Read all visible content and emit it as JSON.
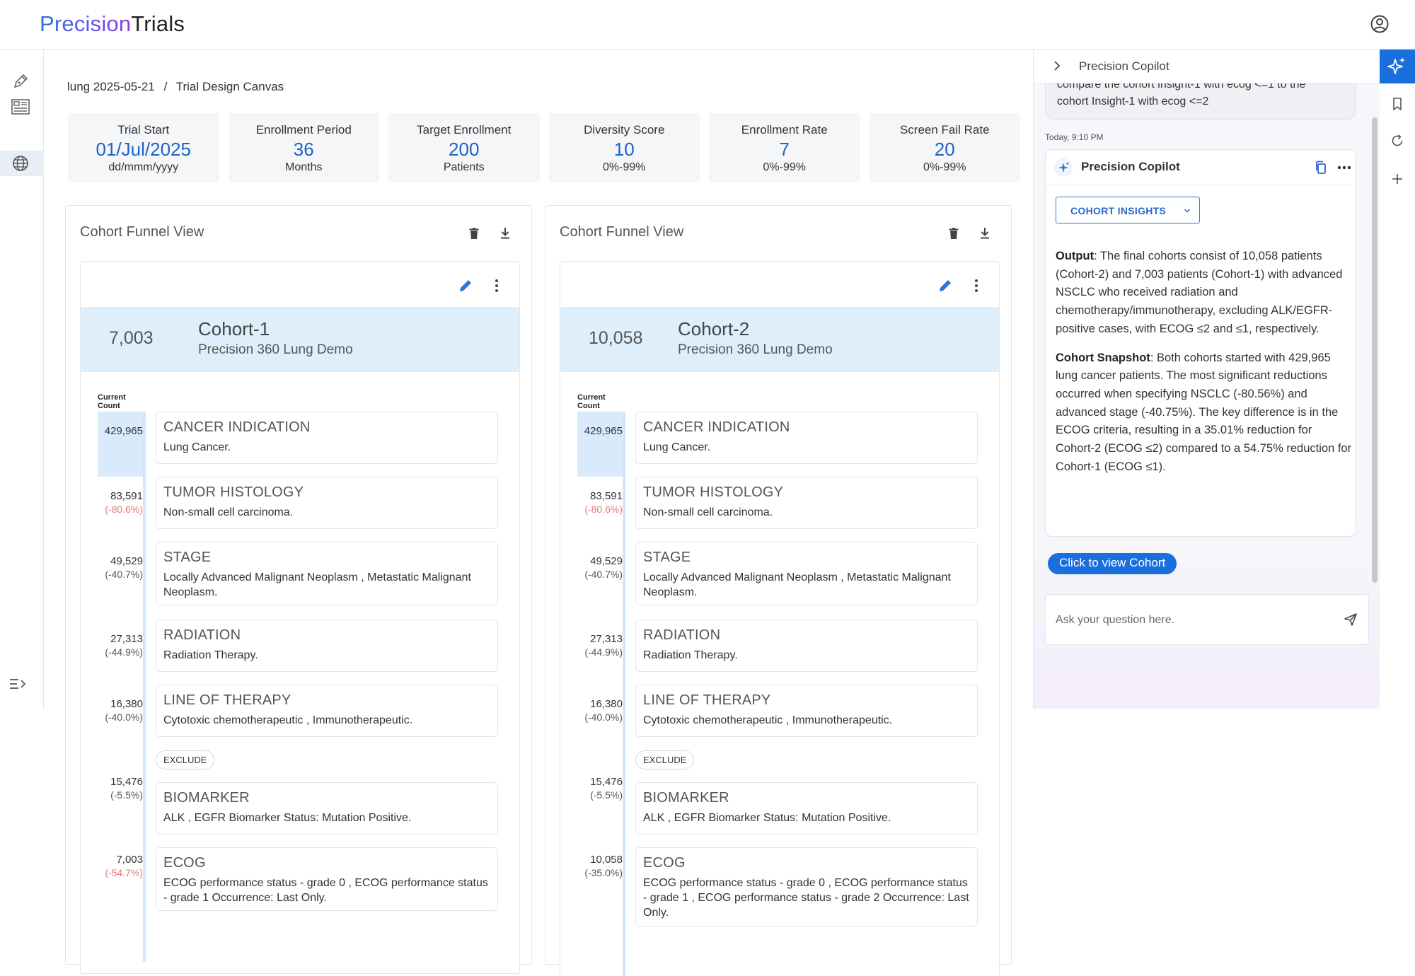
{
  "app": {
    "logo_part1": "Precision",
    "logo_part2": "Trials"
  },
  "breadcrumb": {
    "project": "lung 2025-05-21",
    "separator": "/",
    "page": "Trial Design Canvas"
  },
  "metrics": [
    {
      "label": "Trial Start",
      "value": "01/Jul/2025",
      "sub": "dd/mmm/yyyy"
    },
    {
      "label": "Enrollment Period",
      "value": "36",
      "sub": "Months"
    },
    {
      "label": "Target Enrollment",
      "value": "200",
      "sub": "Patients"
    },
    {
      "label": "Diversity Score",
      "value": "10",
      "sub": "0%-99%"
    },
    {
      "label": "Enrollment Rate",
      "value": "7",
      "sub": "0%-99%"
    },
    {
      "label": "Screen Fail Rate",
      "value": "20",
      "sub": "0%-99%"
    }
  ],
  "panels": [
    {
      "title": "Cohort Funnel View",
      "cohort_count": "7,003",
      "cohort_name": "Cohort-1",
      "cohort_desc": "Precision 360 Lung Demo",
      "current_count_label1": "Current",
      "current_count_label2": "Count",
      "steps": [
        {
          "count": "429,965",
          "pct": "",
          "title": "CANCER INDICATION",
          "desc": "Lung Cancer."
        },
        {
          "count": "83,591",
          "pct": "(-80.6%)",
          "title": "TUMOR HISTOLOGY",
          "desc": "Non-small cell carcinoma."
        },
        {
          "count": "49,529",
          "pct": "(-40.7%)",
          "title": "STAGE",
          "desc": "Locally Advanced Malignant Neoplasm , Metastatic Malignant Neoplasm."
        },
        {
          "count": "27,313",
          "pct": "(-44.9%)",
          "title": "RADIATION",
          "desc": "Radiation Therapy."
        },
        {
          "count": "16,380",
          "pct": "(-40.0%)",
          "title": "LINE OF THERAPY",
          "desc": "Cytotoxic chemotherapeutic , Immunotherapeutic."
        },
        {
          "count": "15,476",
          "pct": "(-5.5%)",
          "title": "BIOMARKER",
          "desc": "ALK , EGFR Biomarker Status: Mutation Positive."
        },
        {
          "count": "7,003",
          "pct": "(-54.7%)",
          "title": "ECOG",
          "desc": "ECOG performance status - grade 0 , ECOG performance status - grade 1 Occurrence: Last Only."
        }
      ],
      "exclude_label": "EXCLUDE"
    },
    {
      "title": "Cohort Funnel View",
      "cohort_count": "10,058",
      "cohort_name": "Cohort-2",
      "cohort_desc": "Precision 360 Lung Demo",
      "current_count_label1": "Current",
      "current_count_label2": "Count",
      "steps": [
        {
          "count": "429,965",
          "pct": "",
          "title": "CANCER INDICATION",
          "desc": "Lung Cancer."
        },
        {
          "count": "83,591",
          "pct": "(-80.6%)",
          "title": "TUMOR HISTOLOGY",
          "desc": "Non-small cell carcinoma."
        },
        {
          "count": "49,529",
          "pct": "(-40.7%)",
          "title": "STAGE",
          "desc": "Locally Advanced Malignant Neoplasm , Metastatic Malignant Neoplasm."
        },
        {
          "count": "27,313",
          "pct": "(-44.9%)",
          "title": "RADIATION",
          "desc": "Radiation Therapy."
        },
        {
          "count": "16,380",
          "pct": "(-40.0%)",
          "title": "LINE OF THERAPY",
          "desc": "Cytotoxic chemotherapeutic , Immunotherapeutic."
        },
        {
          "count": "15,476",
          "pct": "(-5.5%)",
          "title": "BIOMARKER",
          "desc": "ALK , EGFR Biomarker Status: Mutation Positive."
        },
        {
          "count": "10,058",
          "pct": "(-35.0%)",
          "title": "ECOG",
          "desc": "ECOG performance status - grade 0 , ECOG performance status - grade 1 , ECOG performance status - grade 2 Occurrence: Last Only."
        }
      ],
      "exclude_label": "EXCLUDE"
    }
  ],
  "copilot": {
    "title": "Precision Copilot",
    "prev_line1": "compare the cohort insight-1 with ecog <=1 to the",
    "prev_line2": "cohort Insight-1 with ecog <=2",
    "timestamp": "Today, 9:10 PM",
    "response_name": "Precision Copilot",
    "insights_button": "COHORT INSIGHTS",
    "output_label": "Output",
    "output_text": ": The final cohorts consist of 10,058 patients (Cohort-2) and 7,003 patients (Cohort-1) with advanced NSCLC who received radiation and chemotherapy/immunotherapy, excluding ALK/EGFR-positive cases, with ECOG ≤2 and ≤1, respectively.",
    "snapshot_label": "Cohort Snapshot",
    "snapshot_text": ": Both cohorts started with 429,965 lung cancer patients. The most significant reductions occurred when specifying NSCLC (-80.56%) and advanced stage (-40.75%). The key difference is in the ECOG criteria, resulting in a 35.01% reduction for Cohort-2 (ECOG ≤2) compared to a 54.75% reduction for Cohort-1 (ECOG ≤1).",
    "view_button": "Click to view Cohort",
    "ask_placeholder": "Ask your question here."
  },
  "colors": {
    "accent": "#1a6fdf",
    "metric_value": "#1c63c8",
    "cohort_header": "#deeffb",
    "negative_pct": "#e07a7a"
  },
  "icons": [
    "user-icon",
    "pen-icon",
    "layout-icon",
    "globe-icon",
    "menu-expand-icon",
    "trash-icon",
    "download-icon",
    "edit-icon",
    "more-vertical-icon",
    "chevron-right-icon",
    "sparkle-icon",
    "copy-icon",
    "more-horizontal-icon",
    "chevron-down-icon",
    "send-icon",
    "bookmark-icon",
    "refresh-icon",
    "plus-icon"
  ]
}
